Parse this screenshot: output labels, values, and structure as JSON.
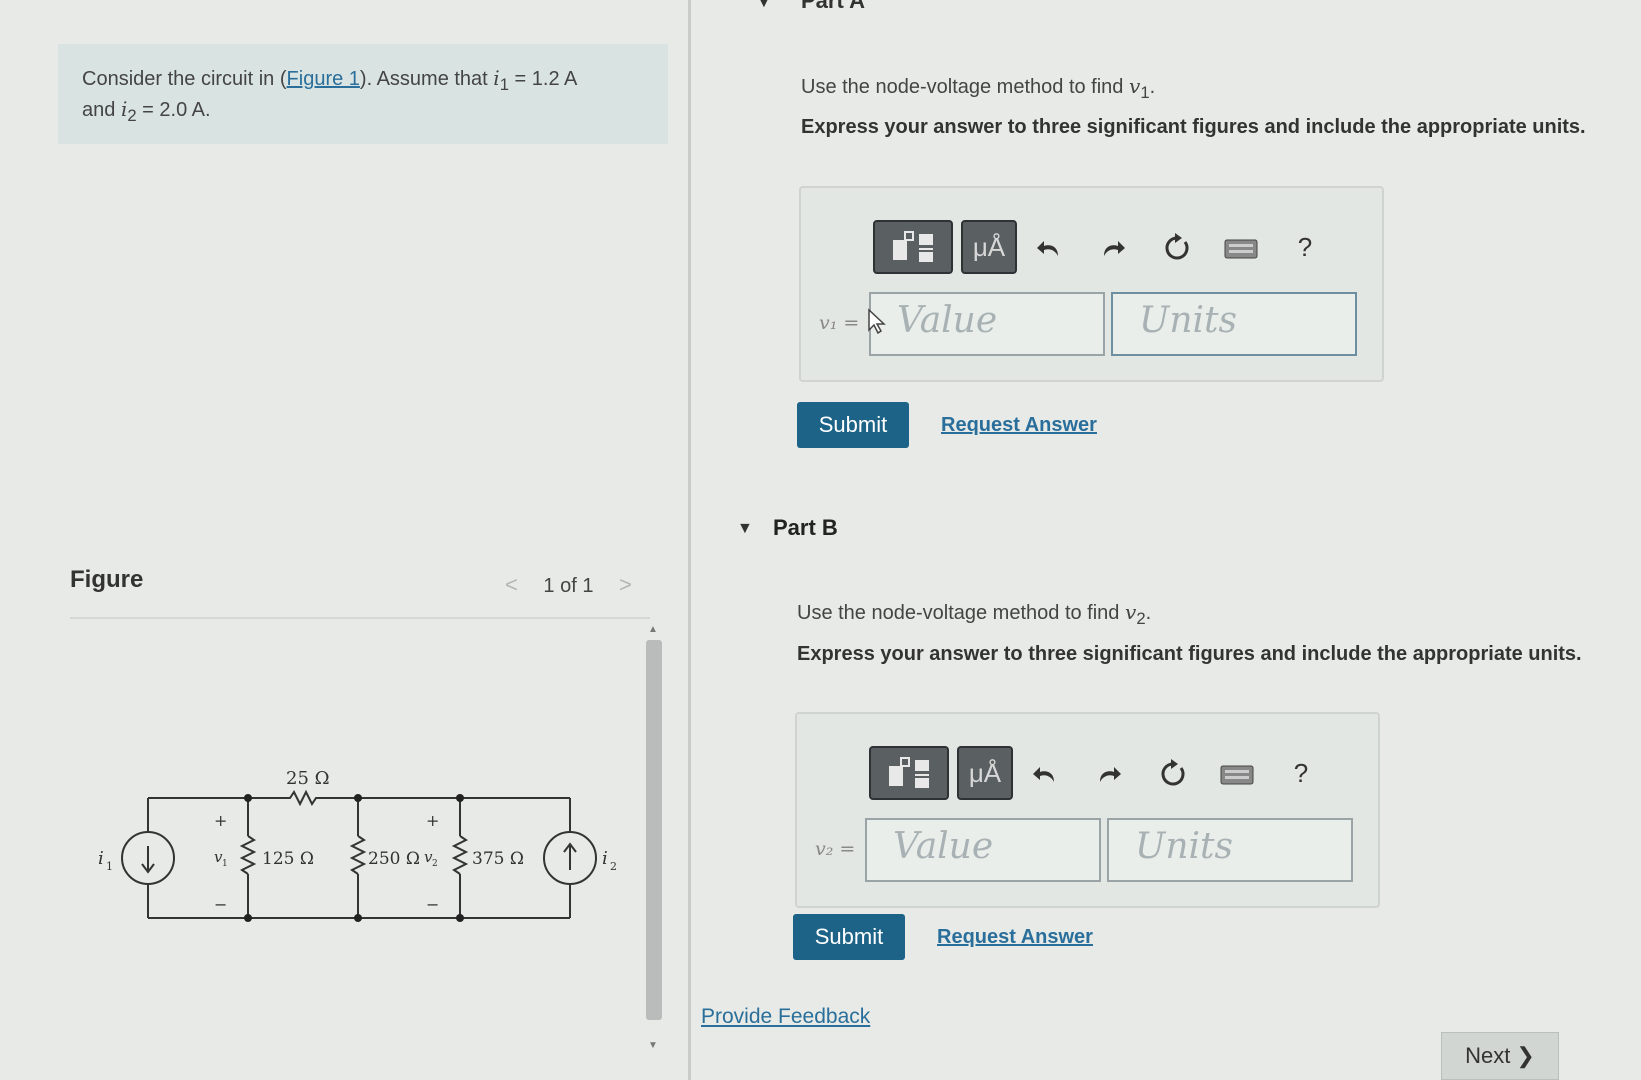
{
  "problem": {
    "line1_prefix": "Consider the circuit in (",
    "figure_link": "Figure 1",
    "line1_mid": "). Assume that ",
    "i1": "i",
    "i1_sub": "1",
    "i1_val": " = 1.2 A",
    "line2_prefix": "and ",
    "i2": "i",
    "i2_sub": "2",
    "i2_val": " = 2.0 A."
  },
  "figure": {
    "title": "Figure",
    "pager": "1 of 1",
    "prev_arrow": "<",
    "next_arrow": ">",
    "circuit": {
      "r_top": "25 Ω",
      "r1": "125 Ω",
      "r2": "250 Ω",
      "r3": "375 Ω",
      "src_left": "i",
      "src_left_sub": "1",
      "src_right": "i",
      "src_right_sub": "2",
      "v1": "v",
      "v1_sub": "1",
      "v2": "v",
      "v2_sub": "2",
      "plus": "+",
      "minus": "−"
    }
  },
  "part_a": {
    "header_fragment": "Part A",
    "instruction_prefix": "Use the node-voltage method to find ",
    "instruction_var": "v",
    "instruction_sub": "1",
    "instruction_suffix": ".",
    "express": "Express your answer to three significant figures and include the appropriate units.",
    "var_label": "v₁ =",
    "value_placeholder": "Value",
    "units_placeholder": "Units",
    "submit": "Submit",
    "request": "Request Answer"
  },
  "part_b": {
    "header": "Part B",
    "instruction_prefix": "Use the node-voltage method to find ",
    "instruction_var": "v",
    "instruction_sub": "2",
    "instruction_suffix": ".",
    "express": "Express your answer to three significant figures and include the appropriate units.",
    "var_label": "v₂ =",
    "value_placeholder": "Value",
    "units_placeholder": "Units",
    "submit": "Submit",
    "request": "Request Answer"
  },
  "toolbar": {
    "units_btn": "μÅ",
    "help": "?",
    "icons": [
      "templates-icon",
      "units-icon",
      "undo-icon",
      "redo-icon",
      "reset-icon",
      "keyboard-icon",
      "help-icon"
    ]
  },
  "footer": {
    "feedback": "Provide Feedback",
    "next": "Next",
    "next_arrow": "❯"
  },
  "colors": {
    "submit": "#1c6387",
    "link": "#2a6f9b",
    "problem_bg": "#d9e4e2"
  }
}
